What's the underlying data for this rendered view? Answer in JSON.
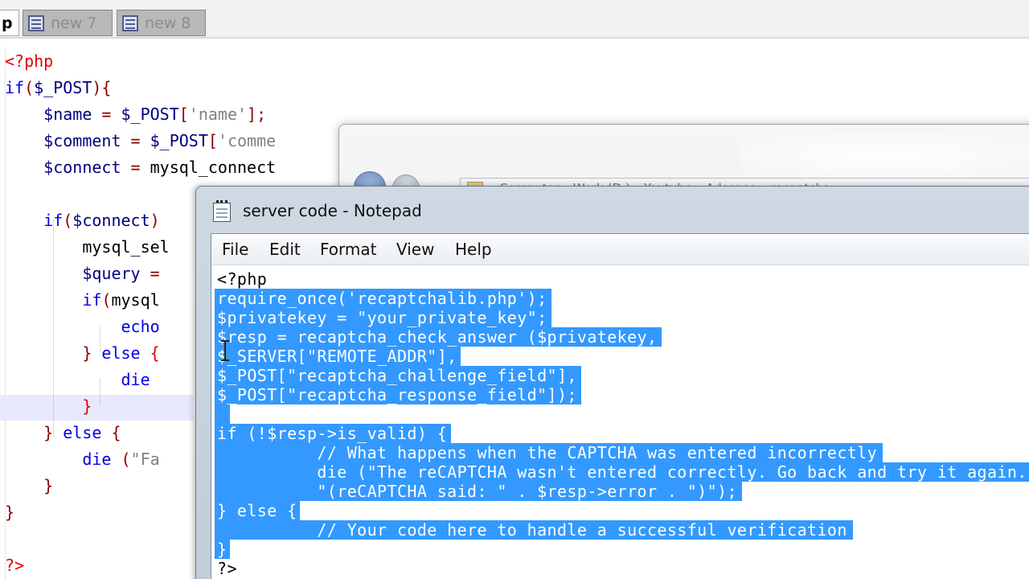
{
  "tabs": {
    "active_label": "p",
    "inactive": [
      "new 7",
      "new 8"
    ]
  },
  "editor": {
    "lines": [
      [
        {
          "t": "<?php",
          "c": "tg"
        }
      ],
      [
        {
          "t": "if",
          "c": "kw"
        },
        {
          "t": "(",
          "c": "op"
        },
        {
          "t": "$_POST",
          "c": "vr"
        },
        {
          "t": "){",
          "c": "op"
        }
      ],
      [
        {
          "t": "    $name",
          "c": "vr"
        },
        {
          "t": " = ",
          "c": "op"
        },
        {
          "t": "$_POST",
          "c": "vr"
        },
        {
          "t": "[",
          "c": "op"
        },
        {
          "t": "'name'",
          "c": "st"
        },
        {
          "t": "];",
          "c": "op"
        }
      ],
      [
        {
          "t": "    $comment",
          "c": "vr"
        },
        {
          "t": " = ",
          "c": "op"
        },
        {
          "t": "$_POST",
          "c": "vr"
        },
        {
          "t": "[",
          "c": "op"
        },
        {
          "t": "'comme",
          "c": "st"
        }
      ],
      [
        {
          "t": "    $connect",
          "c": "vr"
        },
        {
          "t": " = ",
          "c": "op"
        },
        {
          "t": "mysql_connect",
          "c": "fn"
        }
      ],
      [
        {
          "t": "",
          "c": "fn"
        }
      ],
      [
        {
          "t": "    if",
          "c": "kw"
        },
        {
          "t": "(",
          "c": "op"
        },
        {
          "t": "$connect",
          "c": "vr"
        },
        {
          "t": ")",
          "c": "op"
        }
      ],
      [
        {
          "t": "        mysql_sel",
          "c": "fn"
        }
      ],
      [
        {
          "t": "        $query",
          "c": "vr"
        },
        {
          "t": " =",
          "c": "op"
        }
      ],
      [
        {
          "t": "        if",
          "c": "kw"
        },
        {
          "t": "(",
          "c": "op"
        },
        {
          "t": "mysql",
          "c": "fn"
        }
      ],
      [
        {
          "t": "            echo",
          "c": "kw"
        }
      ],
      [
        {
          "t": "        } ",
          "c": "op"
        },
        {
          "t": "else",
          "c": "kw"
        },
        {
          "t": " {",
          "c": "tg"
        }
      ],
      [
        {
          "t": "            die",
          "c": "kw"
        }
      ],
      [
        {
          "t": "        }",
          "c": "tg"
        }
      ],
      [
        {
          "t": "    } ",
          "c": "op"
        },
        {
          "t": "else",
          "c": "kw"
        },
        {
          "t": " {",
          "c": "op"
        }
      ],
      [
        {
          "t": "        die",
          "c": "kw"
        },
        {
          "t": " (",
          "c": "op"
        },
        {
          "t": "\"Fa",
          "c": "st"
        }
      ],
      [
        {
          "t": "    }",
          "c": "op"
        }
      ],
      [
        {
          "t": "}",
          "c": "op"
        }
      ],
      [
        {
          "t": "",
          "c": "fn"
        }
      ],
      [
        {
          "t": "?>",
          "c": "tg"
        }
      ]
    ]
  },
  "background_window": {
    "address_text": "▸ Computer ▸ Work (D:) ▸ Youtube ▸ Adsense ▸ recaptcha"
  },
  "notepad": {
    "title": "server code - Notepad",
    "menu": [
      "File",
      "Edit",
      "Format",
      "View",
      "Help"
    ],
    "lines": [
      "<?php",
      "require_once('recaptchalib.php');",
      "$privatekey = \"your_private_key\";",
      "$resp = recaptcha_check_answer ($privatekey,",
      "$_SERVER[\"REMOTE_ADDR\"],",
      "$_POST[\"recaptcha_challenge_field\"],",
      "$_POST[\"recaptcha_response_field\"]);",
      "",
      "if (!$resp->is_valid) {",
      "          // What happens when the CAPTCHA was entered incorrectly",
      "          die (\"The reCAPTCHA wasn't entered correctly. Go back and try it again.\" .",
      "          \"(reCAPTCHA said: \" . $resp->error . \")\");",
      "} else {",
      "          // Your code here to handle a successful verification",
      "}",
      "?>"
    ],
    "selected_from": 1,
    "selected_to": 14
  }
}
